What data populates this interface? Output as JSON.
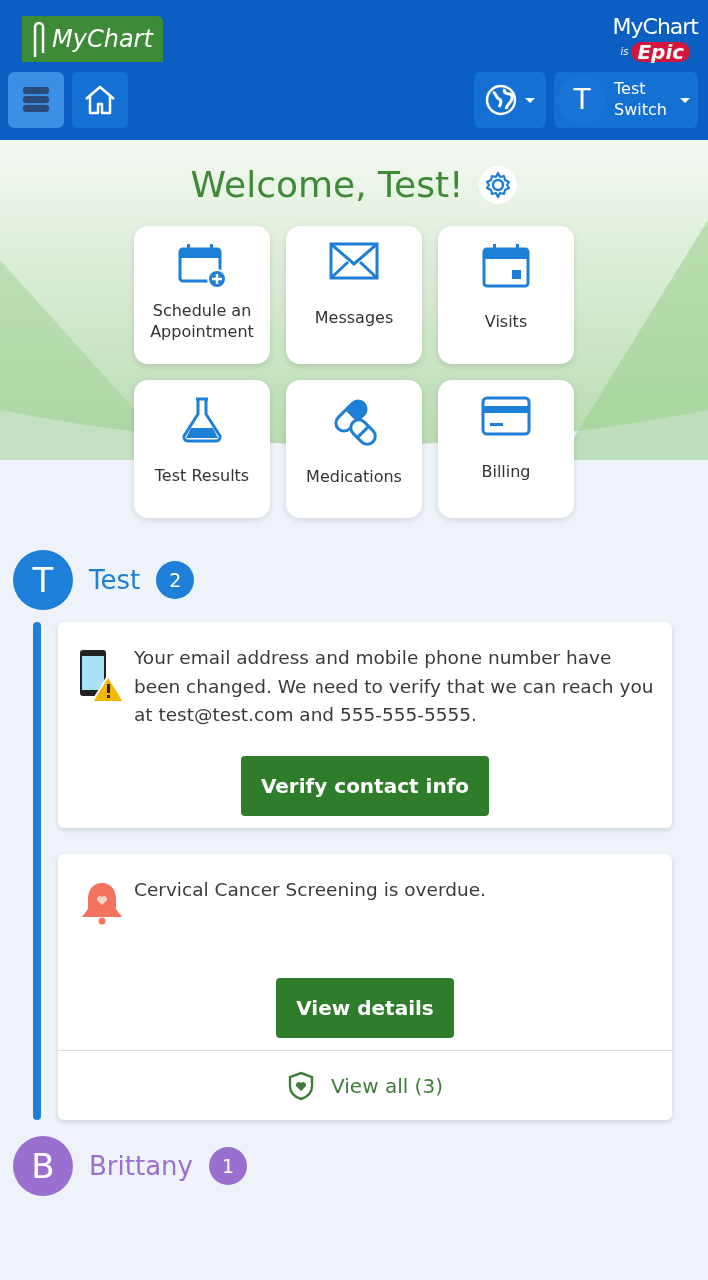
{
  "header": {
    "logo": "MyChart",
    "brand_top": "MyChart",
    "brand_is": "is",
    "brand_name": "Epic",
    "menu_selected": true,
    "user": {
      "initial": "T",
      "name": "Test",
      "action": "Switch"
    }
  },
  "welcome": "Welcome, Test!",
  "tiles": [
    {
      "kind": "schedule",
      "label": "Schedule an Appointment"
    },
    {
      "kind": "messages",
      "label": "Messages"
    },
    {
      "kind": "visits",
      "label": "Visits"
    },
    {
      "kind": "results",
      "label": "Test Results"
    },
    {
      "kind": "medications",
      "label": "Medications"
    },
    {
      "kind": "billing",
      "label": "Billing"
    }
  ],
  "people": [
    {
      "initial": "T",
      "name": "Test",
      "count": "2",
      "color": "#1e7fd8",
      "cards": [
        {
          "kind": "contact",
          "text": "Your email address and mobile phone number have been changed. We need to verify that we can reach you at test@test.com and 555-555-5555.",
          "button": "Verify contact info"
        },
        {
          "kind": "overdue",
          "text": "Cervical Cancer Screening is overdue.",
          "button": "View details",
          "footer": "View all (3)"
        }
      ]
    },
    {
      "initial": "B",
      "name": "Brittany",
      "count": "1",
      "color": "#9b6fd0"
    }
  ]
}
